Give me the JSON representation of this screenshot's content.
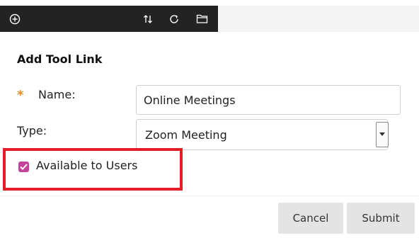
{
  "toolbar": {
    "icons": [
      "add-circle-icon",
      "sort-arrows-icon",
      "refresh-icon",
      "folder-icon"
    ]
  },
  "panel": {
    "title": "Add Tool Link",
    "name_label": "Name:",
    "name_value": "Online Meetings",
    "type_label": "Type:",
    "type_value": "Zoom Meeting",
    "available_label": "Available to Users",
    "available_checked": true
  },
  "buttons": {
    "cancel": "Cancel",
    "submit": "Submit"
  },
  "colors": {
    "toolbar_dark": "#232323",
    "required_star": "#e58a1f",
    "checkbox": "#c2449b",
    "highlight": "#e41e26"
  }
}
